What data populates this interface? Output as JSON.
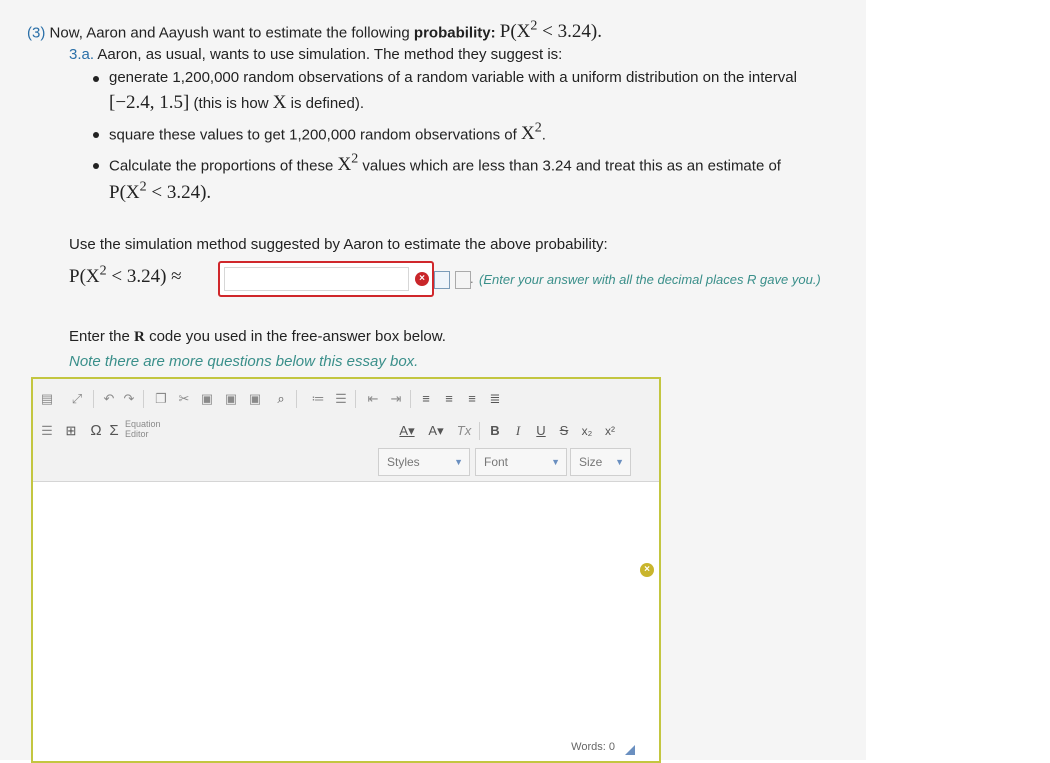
{
  "question": {
    "number": "(3)",
    "intro": "Now, Aaron and Aayush want to estimate the following",
    "intro_bold": "probability:",
    "formula_p": "P(X",
    "formula_exp": "2",
    "formula_rest": " < 3.24)",
    "formula_end": "."
  },
  "part_a": {
    "number": "3.a.",
    "text": "Aaron, as usual, wants to use simulation. The method they suggest is:"
  },
  "bullets": {
    "b1_line1": "generate 1,200,000 random observations of a random variable with a uniform distribution on the interval",
    "b1_interval": "[−2.4, 1.5]",
    "b1_line2_rest": "(this is how",
    "b1_var": "X",
    "b1_line2_end": "is defined).",
    "b2_text": "square these values to get 1,200,000 random observations of",
    "b2_var": "X",
    "b2_exp": "2",
    "b2_end": ".",
    "b3_text_a": "Calculate the proportions of these",
    "b3_var": "X",
    "b3_exp": "2",
    "b3_text_b": "values which are less than 3.24 and treat this as an estimate of",
    "b3_formula_p": "P(X",
    "b3_formula_exp": "2",
    "b3_formula_rest": " < 3.24)",
    "b3_end": "."
  },
  "instruction": "Use the simulation method suggested by Aaron to estimate the above probability:",
  "answer": {
    "formula_p": "P(X",
    "formula_exp": "2",
    "formula_rest": " < 3.24) ≈",
    "value": "",
    "error_icon": "×",
    "hint_dot": ".",
    "hint": "(Enter your answer with all the decimal places R gave you.)"
  },
  "code_prompt": {
    "pre": "Enter the",
    "bold": "R",
    "post": "code you used in the free-answer box below."
  },
  "note": "Note there are more questions below this essay box.",
  "editor": {
    "equation_line1": "Equation",
    "equation_line2": "Editor",
    "styles": "Styles",
    "font": "Font",
    "size": "Size",
    "words_label": "Words:",
    "words_count": "0",
    "bold": "B",
    "italic": "I",
    "underline": "U",
    "strike": "S",
    "subscript": "x₂",
    "superscript": "x²",
    "font_color": "A",
    "bg_color": "A",
    "remove_format": "Tx",
    "omega": "Ω",
    "sigma": "Σ",
    "status_icon": "×"
  },
  "colors": {
    "accent_blue": "#2a6fa8",
    "note_teal": "#3a8f8a",
    "error_red": "#d0272b",
    "editor_border": "#c3c640"
  }
}
